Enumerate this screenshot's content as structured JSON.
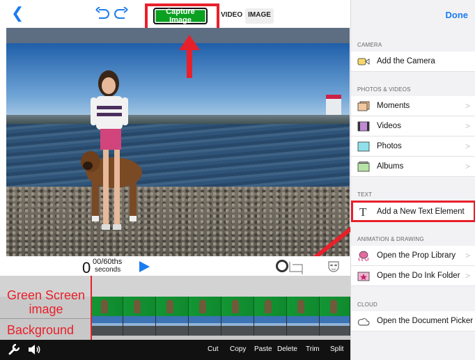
{
  "toolbar": {
    "capture_label": "Capture Image",
    "mode_video": "VIDEO",
    "mode_image": "IMAGE",
    "done_label": "Done"
  },
  "time": {
    "big": "0",
    "frac": "00/60ths",
    "unit": "seconds"
  },
  "annotations": {
    "green_screen": "Green Screen image",
    "background": "Background"
  },
  "bottom_actions": [
    "Cut",
    "Copy",
    "Paste",
    "Delete",
    "Trim",
    "Split"
  ],
  "panel": {
    "sections": [
      {
        "title": "CAMERA"
      },
      {
        "title": "PHOTOS & VIDEOS"
      },
      {
        "title": "TEXT"
      },
      {
        "title": "ANIMATION & DRAWING"
      },
      {
        "title": "CLOUD"
      }
    ],
    "items": [
      {
        "label": "Add the Camera",
        "icon": "camera-icon",
        "chevron": ""
      },
      {
        "label": "Moments",
        "icon": "moments-icon",
        "chevron": ">"
      },
      {
        "label": "Videos",
        "icon": "film-icon",
        "chevron": ">"
      },
      {
        "label": "Photos",
        "icon": "photo-icon",
        "chevron": ">"
      },
      {
        "label": "Albums",
        "icon": "album-icon",
        "chevron": ">"
      },
      {
        "label": "Add a New Text Element",
        "icon": "text-icon",
        "chevron": ""
      },
      {
        "label": "Open the Prop Library",
        "icon": "octopus-icon",
        "chevron": ">"
      },
      {
        "label": "Open the Do Ink Folder",
        "icon": "folder-icon",
        "chevron": ">"
      },
      {
        "label": "Open the Document Picker",
        "icon": "cloud-icon",
        "chevron": ""
      }
    ]
  },
  "colors": {
    "accent": "#1a7cf0",
    "capture": "#0aa020",
    "annotation": "#e8202a"
  }
}
